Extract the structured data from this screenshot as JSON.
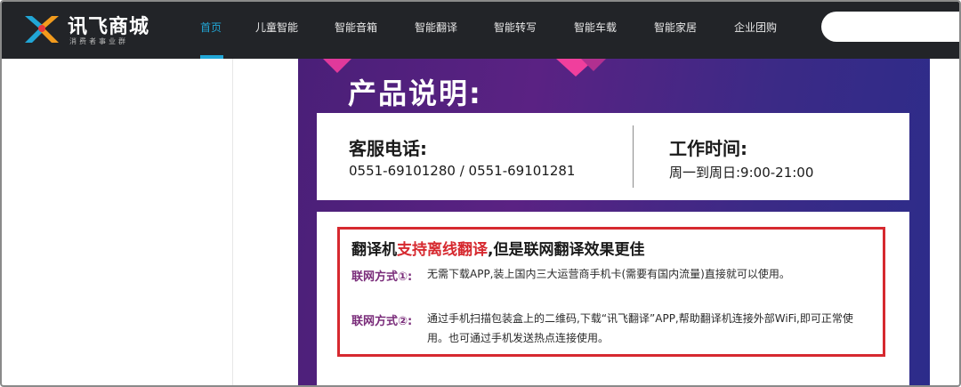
{
  "brand": {
    "name": "讯飞商城",
    "slogan": "消费者事业群",
    "colors": {
      "accent": "#21a6d6",
      "navbar_bg": "#222428",
      "highlight_red": "#d6292f"
    }
  },
  "nav": {
    "items": [
      {
        "label": "首页",
        "active": true
      },
      {
        "label": "儿童智能"
      },
      {
        "label": "智能音箱"
      },
      {
        "label": "智能翻译"
      },
      {
        "label": "智能转写"
      },
      {
        "label": "智能车载"
      },
      {
        "label": "智能家居"
      },
      {
        "label": "企业团购"
      }
    ],
    "search_placeholder": ""
  },
  "poster": {
    "title": "产品说明:",
    "service_label": "客服电话:",
    "service_phones": "0551-69101280 / 0551-69101281",
    "hours_label": "工作时间:",
    "hours_value": "周一到周日:9:00-21:00",
    "desc_title_prefix": "翻译机",
    "desc_title_highlight": "支持离线翻译",
    "desc_title_suffix": ",但是联网翻译效果更佳",
    "methods": [
      {
        "label": "联网方式①:",
        "text": "无需下载APP,装上国内三大运营商手机卡(需要有国内流量)直接就可以使用。"
      },
      {
        "label": "联网方式②:",
        "text": "通过手机扫描包装盒上的二维码,下载“讯飞翻译”APP,帮助翻译机连接外部WiFi,即可正常使用。也可通过手机发送热点连接使用。"
      }
    ]
  }
}
